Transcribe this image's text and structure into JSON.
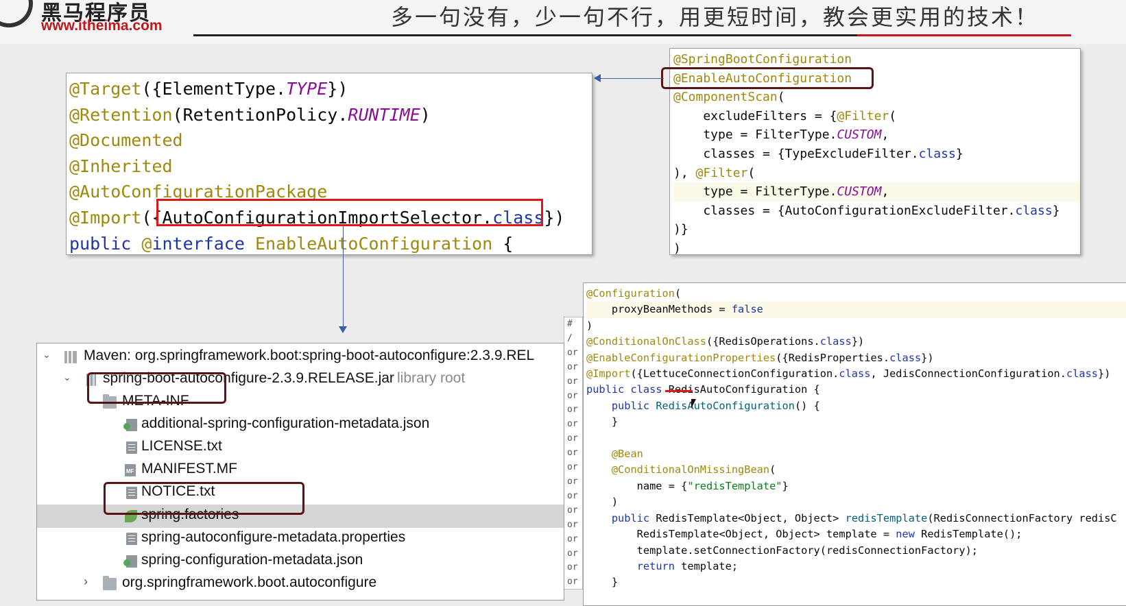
{
  "header": {
    "logo_cn": "黑马程序员",
    "logo_url": "www.itheima.com",
    "slogan": "多一句没有，少一句不行，用更短时间，教会更实用的技术！"
  },
  "enable_auto_config_code": {
    "lines": [
      "@Target({ElementType.TYPE})",
      "@Retention(RetentionPolicy.RUNTIME)",
      "@Documented",
      "@Inherited",
      "@AutoConfigurationPackage",
      "@Import({AutoConfigurationImportSelector.class})",
      "public @interface EnableAutoConfiguration {"
    ],
    "highlighted": "AutoConfigurationImportSelector.class"
  },
  "spring_boot_application_code": {
    "lines": [
      "@SpringBootConfiguration",
      "@EnableAutoConfiguration",
      "@ComponentScan(",
      "    excludeFilters = {@Filter(",
      "    type = FilterType.CUSTOM,",
      "    classes = {TypeExcludeFilter.class}",
      "), @Filter(",
      "    type = FilterType.CUSTOM,",
      "    classes = {AutoConfigurationExcludeFilter.class}",
      ")}",
      ")"
    ],
    "highlighted": "@EnableAutoConfiguration"
  },
  "redis_auto_config_code": {
    "lines": [
      "@Configuration(",
      "    proxyBeanMethods = false",
      ")",
      "@ConditionalOnClass({RedisOperations.class})",
      "@EnableConfigurationProperties({RedisProperties.class})",
      "@Import({LettuceConnectionConfiguration.class, JedisConnectionConfiguration.class})",
      "public class RedisAutoConfiguration {",
      "    public RedisAutoConfiguration() {",
      "    }",
      "",
      "    @Bean",
      "    @ConditionalOnMissingBean(",
      "        name = {\"redisTemplate\"}",
      "    )",
      "    public RedisTemplate<Object, Object> redisTemplate(RedisConnectionFactory redisC",
      "        RedisTemplate<Object, Object> template = new RedisTemplate();",
      "        template.setConnectionFactory(redisConnectionFactory);",
      "        return template;",
      "    }"
    ]
  },
  "side_strip": {
    "header": "# /",
    "prefix": "or"
  },
  "project_tree": {
    "items": [
      {
        "label": "Maven: org.springframework.boot:spring-boot-autoconfigure:2.3.9.REL",
        "extra": ""
      },
      {
        "label": "spring-boot-autoconfigure-2.3.9.RELEASE.jar",
        "extra": "library root"
      },
      {
        "label": "META-INF",
        "extra": ""
      },
      {
        "label": "additional-spring-configuration-metadata.json",
        "extra": ""
      },
      {
        "label": "LICENSE.txt",
        "extra": ""
      },
      {
        "label": "MANIFEST.MF",
        "extra": ""
      },
      {
        "label": "NOTICE.txt",
        "extra": ""
      },
      {
        "label": "spring.factories",
        "extra": ""
      },
      {
        "label": "spring-autoconfigure-metadata.properties",
        "extra": ""
      },
      {
        "label": "spring-configuration-metadata.json",
        "extra": ""
      },
      {
        "label": "org.springframework.boot.autoconfigure",
        "extra": ""
      }
    ],
    "selected_item": "spring.factories",
    "mf_icon_label": "MF"
  }
}
